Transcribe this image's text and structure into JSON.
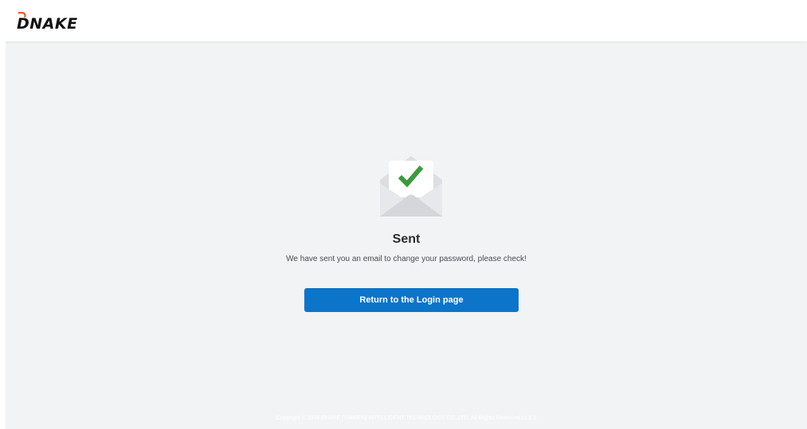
{
  "header": {
    "logo_text": "DNAKE"
  },
  "main": {
    "icon": "envelope-check-icon",
    "title": "Sent",
    "message": "We have sent you an email to change your password, please check!",
    "button_label": "Return to the Login page"
  },
  "footer": {
    "copyright": "Copyright © 2024 DNAKE (XIAMEN) INTELLIGENT TECHNOLOGY CO.,LTD. All Rights Reserved v1.5.0"
  },
  "colors": {
    "accent": "#0c74c9",
    "logo_accent": "#e9541e",
    "check": "#3a9a3a",
    "background": "#f2f3f5"
  }
}
